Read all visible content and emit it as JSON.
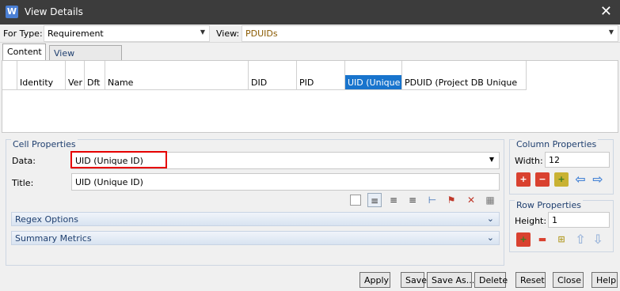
{
  "window": {
    "title": "View Details",
    "app_icon": "W"
  },
  "top": {
    "for_type_label": "For Type:",
    "for_type_value": "Requirement",
    "view_label": "View:",
    "view_value": "PDUIDs"
  },
  "tabs": [
    {
      "label": "Content",
      "active": true
    },
    {
      "label": "View Properties",
      "active": false
    }
  ],
  "grid": {
    "columns": [
      {
        "label": "Identity",
        "selected": false
      },
      {
        "label": "Ver",
        "selected": false
      },
      {
        "label": "Dft",
        "selected": false
      },
      {
        "label": "Name",
        "selected": false
      },
      {
        "label": "DID",
        "selected": false
      },
      {
        "label": "PID",
        "selected": false
      },
      {
        "label": "UID (Unique",
        "selected": true
      },
      {
        "label": "PDUID (Project DB Unique",
        "selected": false
      }
    ]
  },
  "cell_properties": {
    "title": "Cell Properties",
    "data_label": "Data:",
    "data_value": "UID (Unique ID)",
    "title_label": "Title:",
    "title_value": "UID (Unique ID)",
    "regex_label": "Regex Options",
    "summary_label": "Summary Metrics"
  },
  "column_properties": {
    "title": "Column Properties",
    "width_label": "Width:",
    "width_value": "12"
  },
  "row_properties": {
    "title": "Row Properties",
    "height_label": "Height:",
    "height_value": "1"
  },
  "buttons": {
    "apply": "Apply",
    "save": "Save",
    "save_as": "Save As...",
    "delete": "Delete",
    "reset": "Reset",
    "close": "Close",
    "help": "Help"
  },
  "colors": {
    "accent": "#1874cd",
    "highlight_box": "#e60000",
    "titlebar": "#3c3c3c"
  }
}
